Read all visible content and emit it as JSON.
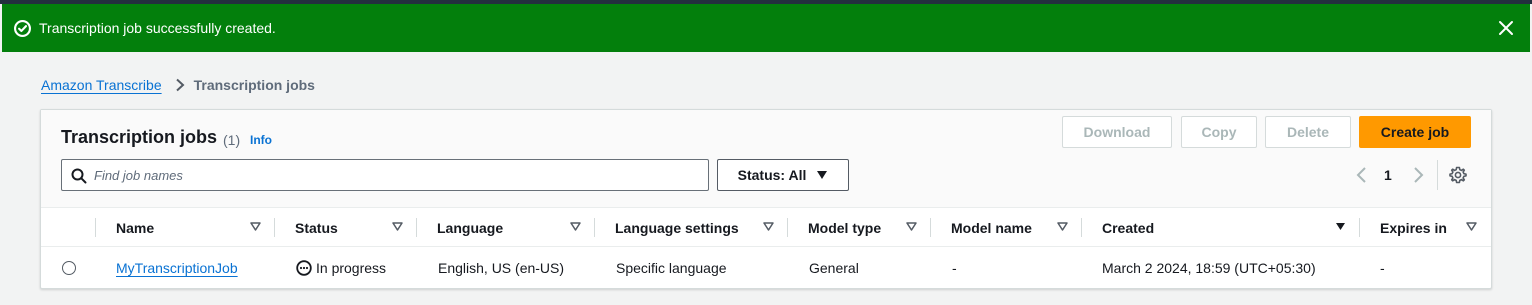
{
  "flash": {
    "message": "Transcription job successfully created.",
    "type": "success",
    "icon": "check-circle-icon",
    "close_icon": "close-icon",
    "color": "#037f0c"
  },
  "breadcrumb": {
    "items": [
      "Amazon Transcribe",
      "Transcription jobs"
    ]
  },
  "header": {
    "title": "Transcription jobs",
    "count": "(1)",
    "info": "Info"
  },
  "actions": {
    "download": "Download",
    "copy": "Copy",
    "delete": "Delete",
    "create": "Create job",
    "primary_color": "#ff9900"
  },
  "filters": {
    "search_placeholder": "Find job names",
    "search_value": "",
    "status_label": "Status: All"
  },
  "pagination": {
    "current_page": "1"
  },
  "table": {
    "columns": [
      "Name",
      "Status",
      "Language",
      "Language settings",
      "Model type",
      "Model name",
      "Created",
      "Expires in"
    ],
    "sorted_column": "Created",
    "rows": [
      {
        "name": "MyTranscriptionJob",
        "status": "In progress",
        "language": "English, US (en-US)",
        "language_settings": "Specific language",
        "model_type": "General",
        "model_name": "-",
        "created": "March 2 2024, 18:59 (UTC+05:30)",
        "expires_in": "-"
      }
    ]
  }
}
